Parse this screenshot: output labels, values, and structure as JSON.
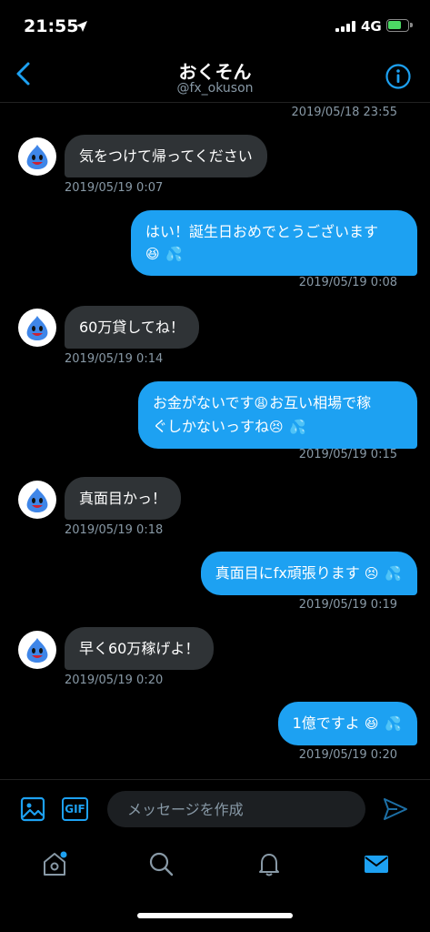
{
  "status_bar": {
    "time": "21:55",
    "location_icon": "location-arrow-icon",
    "network": "4G",
    "battery_charging": true
  },
  "header": {
    "title": "おくそん",
    "handle": "@fx_okuson",
    "back_icon": "chevron-left-icon",
    "info_icon": "info-icon"
  },
  "thread": {
    "top_timestamp": "2019/05/18 23:55",
    "messages": [
      {
        "dir": "in",
        "text": "気をつけて帰ってください",
        "time": "2019/05/19 0:07"
      },
      {
        "dir": "out",
        "line1": "はい！誕生日おめでとうございます",
        "line2_emoji": "😆 💦",
        "time": "2019/05/19 0:08"
      },
      {
        "dir": "in",
        "text": "60万貸してね！",
        "time": "2019/05/19 0:14"
      },
      {
        "dir": "out",
        "line1_text": "お金がないです",
        "line1_emoji": "😩",
        "line1_rest": "お互い相場で稼",
        "line2_text": "ぐしかないっすね",
        "line2_emoji": "😣 💦",
        "time": "2019/05/19 0:15"
      },
      {
        "dir": "in",
        "text": "真面目かっ！",
        "time": "2019/05/19 0:18"
      },
      {
        "dir": "out",
        "text": "真面目にfx頑張ります",
        "emoji": "😣 💦",
        "time": "2019/05/19 0:19"
      },
      {
        "dir": "in",
        "text": "早く60万稼げよ！",
        "time": "2019/05/19 0:20"
      },
      {
        "dir": "out",
        "text": "1億ですよ",
        "emoji": "😆 💦",
        "time": "2019/05/19 0:20"
      }
    ]
  },
  "composer": {
    "placeholder": "メッセージを作成",
    "gif_label": "GIF",
    "image_icon": "image-icon",
    "send_icon": "send-icon"
  },
  "tab_bar": {
    "items": [
      "home-icon",
      "search-icon",
      "notifications-icon",
      "messages-icon"
    ],
    "active": "messages-icon",
    "home_has_badge": true
  },
  "colors": {
    "accent": "#1da1f2",
    "incoming_bubble": "#2f3336",
    "background": "#000000",
    "secondary_text": "#8899a6"
  }
}
